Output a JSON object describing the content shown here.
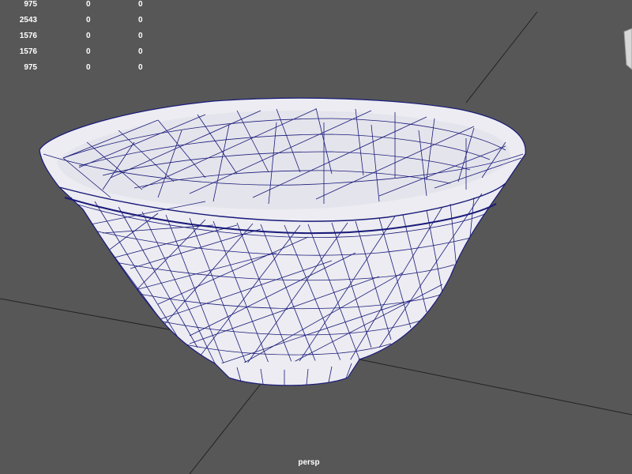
{
  "hud": {
    "rows": [
      [
        "975",
        "0",
        "0"
      ],
      [
        "2543",
        "0",
        "0"
      ],
      [
        "1576",
        "0",
        "0"
      ],
      [
        "1576",
        "0",
        "0"
      ],
      [
        "975",
        "0",
        "0"
      ]
    ]
  },
  "viewport": {
    "camera_label": "persp"
  },
  "colors": {
    "background": "#575757",
    "grid": "#222222",
    "mesh_fill": "#ececf2",
    "wire": "#1a1a7a",
    "hud_text": "#ffffff"
  },
  "icons": {
    "view_cube": "view-cube-icon"
  }
}
